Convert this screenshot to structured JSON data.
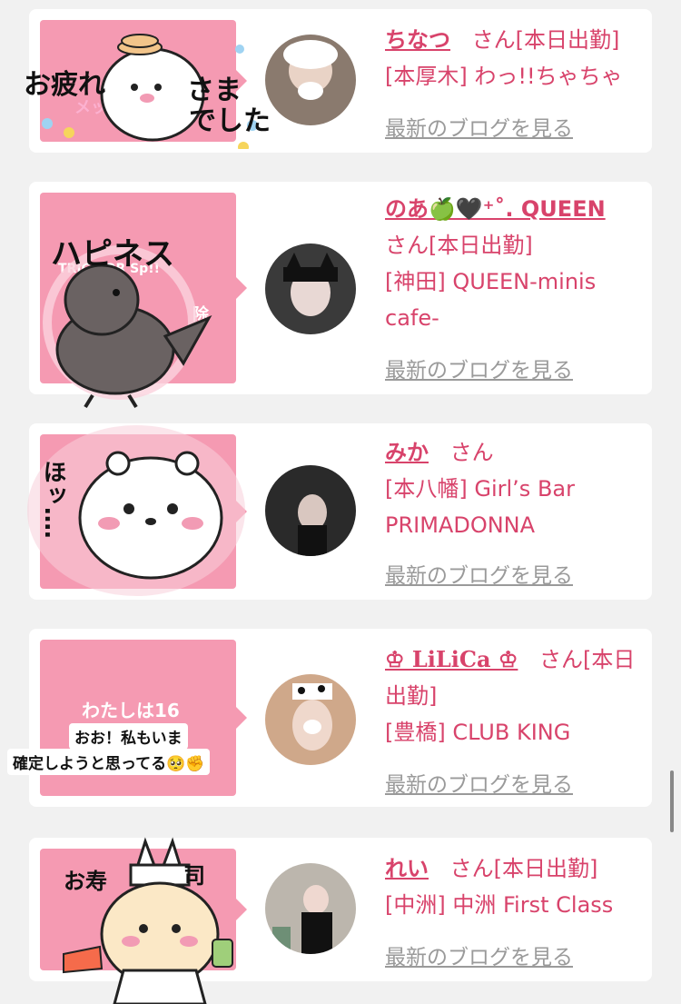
{
  "cards": [
    {
      "name": "ちなつ",
      "honorific": "さん",
      "status": "[本日出勤]",
      "area": "[本厚木]",
      "shop": "わっ!!ちゃちゃ",
      "blog_link": "最新のブログを見る",
      "sticker_text": [
        "お疲れ",
        "さま",
        "でした"
      ],
      "thumb_text": "メッ"
    },
    {
      "name": "のあ🍏🖤⁺˚. QUEEN",
      "honorific": "さん",
      "status": "[本日出勤]",
      "area": "[神田]",
      "shop": "QUEEN-minis cafe-",
      "blog_link": "最新のブログを見る",
      "sticker_text": "ハピネス",
      "thumb_text": "TRICK OR Sp!!",
      "thumb_text2": "除"
    },
    {
      "name": "みか",
      "honorific": "さん",
      "status": "",
      "area": "[本八幡]",
      "shop": "Girl’s Bar PRIMADONNA",
      "blog_link": "最新のブログを見る",
      "sticker_text": "ほッ‥‥"
    },
    {
      "name": "♔ LiLiCa ♔",
      "honorific": "さん",
      "status": "[本日出勤]",
      "area": "[豊橋]",
      "shop": "CLUB KING",
      "blog_link": "最新のブログを見る",
      "thumb_text": "わたしは16",
      "bubble1": "おお！私もいま",
      "bubble2": "確定しようと思ってる🥺✊"
    },
    {
      "name": "れい",
      "honorific": "さん",
      "status": "[本日出勤]",
      "area": "[中洲]",
      "shop": "中洲 First Class",
      "blog_link": "最新のブログを見る",
      "sticker_text": [
        "お寿",
        "司"
      ]
    }
  ],
  "colors": {
    "accent": "#d8436b",
    "thumb_bg": "#f59ab2",
    "link_gray": "#9a9a9a"
  }
}
